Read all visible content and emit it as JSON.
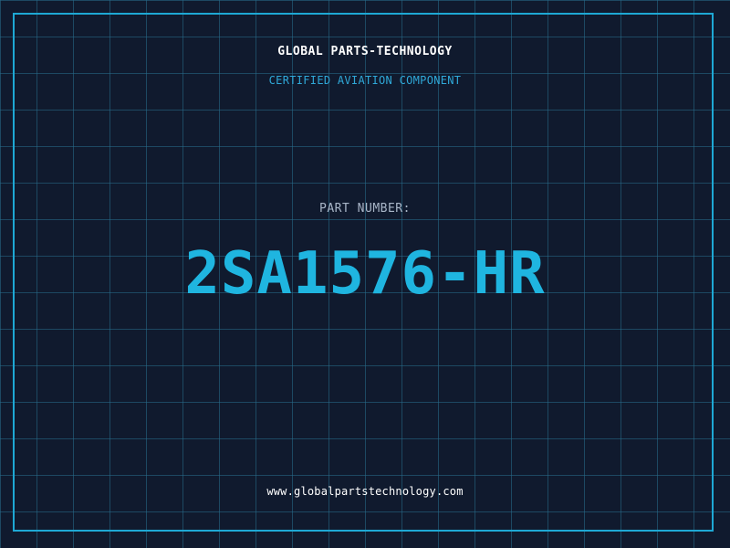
{
  "header": {
    "company": "GLOBAL PARTS-TECHNOLOGY",
    "tagline": "CERTIFIED AVIATION COMPONENT"
  },
  "part": {
    "label": "PART NUMBER:",
    "number": "2SA1576-HR"
  },
  "footer": {
    "website": "www.globalpartstechnology.com"
  },
  "colors": {
    "background": "#101a2e",
    "grid": "#286e8c",
    "accent": "#1fb5e0",
    "text": "#ffffff",
    "label": "#a9b6c8"
  }
}
